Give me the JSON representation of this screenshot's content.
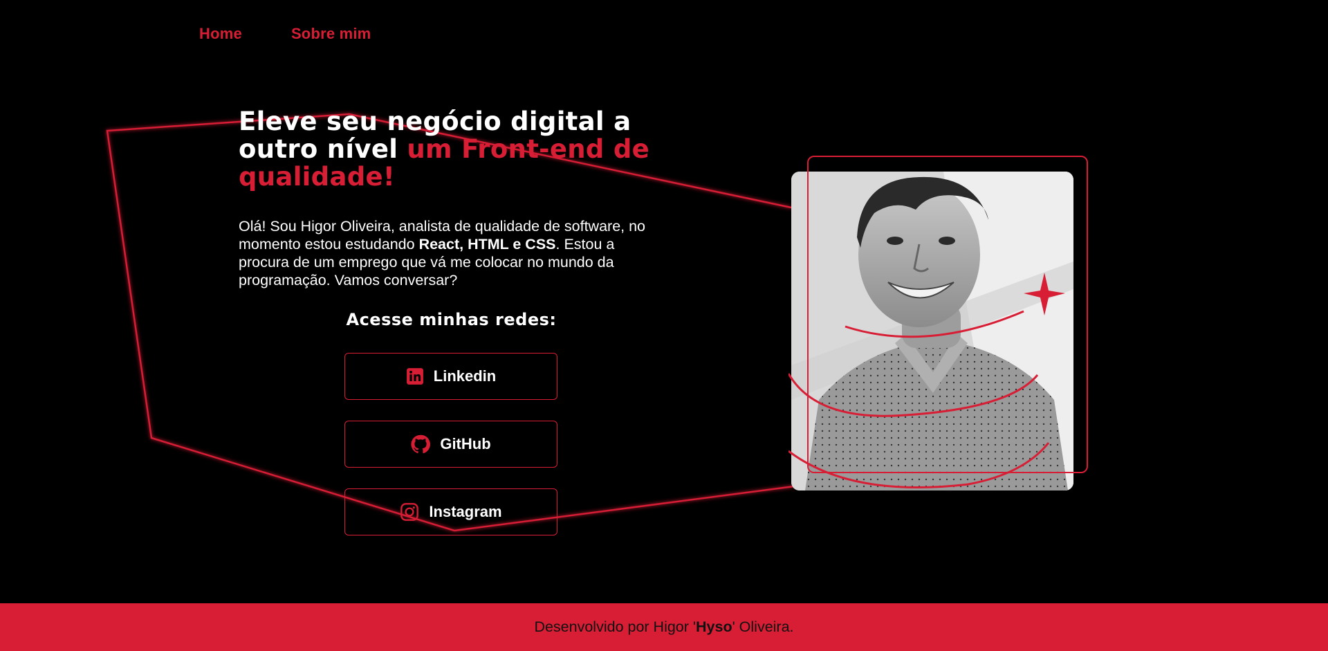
{
  "nav": {
    "items": [
      {
        "label": "Home"
      },
      {
        "label": "Sobre mim"
      }
    ]
  },
  "hero": {
    "title_part1": "Eleve seu negócio digital a outro nível",
    "title_accent": "um Front-end de qualidade!",
    "intro_part1": "Olá! Sou Higor Oliveira, analista de qualidade de software, no momento estou estudando",
    "intro_bold": "React, HTML e CSS",
    "intro_part2": ". Estou a procura de um emprego que vá me colocar no mundo da programação. Vamos conversar?"
  },
  "socials": {
    "title": "Acesse minhas redes:",
    "items": [
      {
        "label": "Linkedin",
        "icon": "linkedin-icon"
      },
      {
        "label": "GitHub",
        "icon": "github-icon"
      },
      {
        "label": "Instagram",
        "icon": "instagram-icon"
      }
    ]
  },
  "footer": {
    "prefix": "Desenvolvido por Higor '",
    "nickname": "Hyso",
    "suffix": "' Oliveira."
  },
  "colors": {
    "accent": "#d71e35",
    "background": "#000000",
    "text": "#ffffff"
  }
}
